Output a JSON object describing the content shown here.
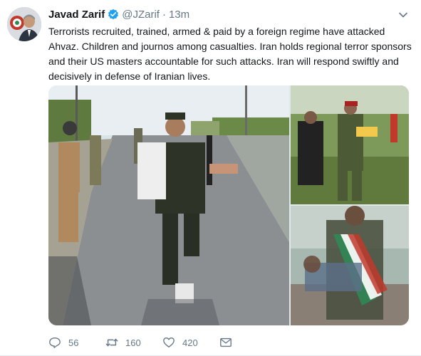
{
  "tweet": {
    "author_name": "Javad Zarif",
    "handle": "@JZarif",
    "separator": "·",
    "time": "13m",
    "verified": true,
    "text": "Terrorists recruited, trained, armed & paid by a foreign regime have attacked Ahvaz. Children and journos among casualties. Iran holds regional terror sponsors and their US masters accountable for such attacks. Iran will respond swiftly and decisively in defense of Iranian lives."
  },
  "actions": {
    "reply_count": "56",
    "retweet_count": "160",
    "like_count": "420"
  },
  "icons": {
    "verified": "verified-badge-icon",
    "caret": "chevron-down-icon",
    "reply": "reply-icon",
    "retweet": "retweet-icon",
    "like": "heart-icon",
    "dm": "envelope-icon"
  },
  "colors": {
    "verified_blue": "#1da1f2",
    "muted": "#657786",
    "text": "#14171a"
  }
}
